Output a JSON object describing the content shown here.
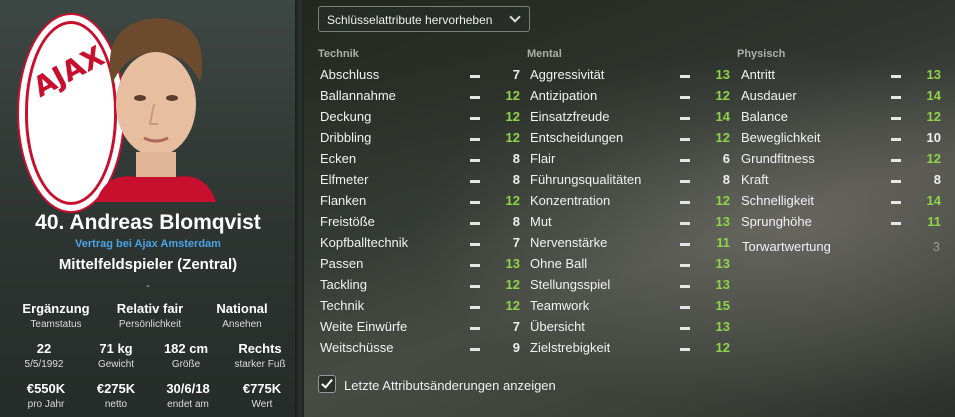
{
  "player": {
    "number_name": "40. Andreas Blomqvist",
    "contract": "Vertrag bei Ajax Amsterdam",
    "position": "Mittelfeldspieler (Zentral)",
    "dash": "-",
    "club_logo_text": "AJAX"
  },
  "stats_row1": [
    {
      "value": "Ergänzung",
      "label": "Teamstatus"
    },
    {
      "value": "Relativ fair",
      "label": "Persönlichkeit"
    },
    {
      "value": "National",
      "label": "Ansehen"
    }
  ],
  "stats_row2": [
    {
      "value": "22",
      "label": "5/5/1992"
    },
    {
      "value": "71 kg",
      "label": "Gewicht"
    },
    {
      "value": "182 cm",
      "label": "Größe"
    },
    {
      "value": "Rechts",
      "label": "starker Fuß"
    }
  ],
  "stats_row3": [
    {
      "value": "€550K",
      "label": "pro Jahr"
    },
    {
      "value": "€275K",
      "label": "netto"
    },
    {
      "value": "30/6/18",
      "label": "endet am"
    },
    {
      "value": "€775K",
      "label": "Wert"
    }
  ],
  "dropdown": {
    "label": "Schlüsselattribute hervorheben"
  },
  "columns": {
    "technik": {
      "title": "Technik",
      "items": [
        {
          "name": "Abschluss",
          "value": "7",
          "hl": false
        },
        {
          "name": "Ballannahme",
          "value": "12",
          "hl": true
        },
        {
          "name": "Deckung",
          "value": "12",
          "hl": true
        },
        {
          "name": "Dribbling",
          "value": "12",
          "hl": true
        },
        {
          "name": "Ecken",
          "value": "8",
          "hl": false
        },
        {
          "name": "Elfmeter",
          "value": "8",
          "hl": false
        },
        {
          "name": "Flanken",
          "value": "12",
          "hl": true
        },
        {
          "name": "Freistöße",
          "value": "8",
          "hl": false
        },
        {
          "name": "Kopfballtechnik",
          "value": "7",
          "hl": false
        },
        {
          "name": "Passen",
          "value": "13",
          "hl": true
        },
        {
          "name": "Tackling",
          "value": "12",
          "hl": true
        },
        {
          "name": "Technik",
          "value": "12",
          "hl": true
        },
        {
          "name": "Weite Einwürfe",
          "value": "7",
          "hl": false
        },
        {
          "name": "Weitschüsse",
          "value": "9",
          "hl": false
        }
      ]
    },
    "mental": {
      "title": "Mental",
      "items": [
        {
          "name": "Aggressivität",
          "value": "13",
          "hl": true
        },
        {
          "name": "Antizipation",
          "value": "12",
          "hl": true
        },
        {
          "name": "Einsatzfreude",
          "value": "14",
          "hl": true
        },
        {
          "name": "Entscheidungen",
          "value": "12",
          "hl": true
        },
        {
          "name": "Flair",
          "value": "6",
          "hl": false
        },
        {
          "name": "Führungsqualitäten",
          "value": "8",
          "hl": false
        },
        {
          "name": "Konzentration",
          "value": "12",
          "hl": true
        },
        {
          "name": "Mut",
          "value": "13",
          "hl": true
        },
        {
          "name": "Nervenstärke",
          "value": "11",
          "hl": true
        },
        {
          "name": "Ohne Ball",
          "value": "13",
          "hl": true
        },
        {
          "name": "Stellungsspiel",
          "value": "13",
          "hl": true
        },
        {
          "name": "Teamwork",
          "value": "15",
          "hl": true
        },
        {
          "name": "Übersicht",
          "value": "13",
          "hl": true
        },
        {
          "name": "Zielstrebigkeit",
          "value": "12",
          "hl": true
        }
      ]
    },
    "physisch": {
      "title": "Physisch",
      "items": [
        {
          "name": "Antritt",
          "value": "13",
          "hl": true
        },
        {
          "name": "Ausdauer",
          "value": "14",
          "hl": true
        },
        {
          "name": "Balance",
          "value": "12",
          "hl": true
        },
        {
          "name": "Beweglichkeit",
          "value": "10",
          "hl": false
        },
        {
          "name": "Grundfitness",
          "value": "12",
          "hl": true
        },
        {
          "name": "Kraft",
          "value": "8",
          "hl": false
        },
        {
          "name": "Schnelligkeit",
          "value": "14",
          "hl": true
        },
        {
          "name": "Sprunghöhe",
          "value": "11",
          "hl": true
        }
      ]
    },
    "torwart": {
      "name": "Torwartwertung",
      "value": "3"
    }
  },
  "checkbox": {
    "label": "Letzte Attributsänderungen anzeigen",
    "checked": true
  }
}
